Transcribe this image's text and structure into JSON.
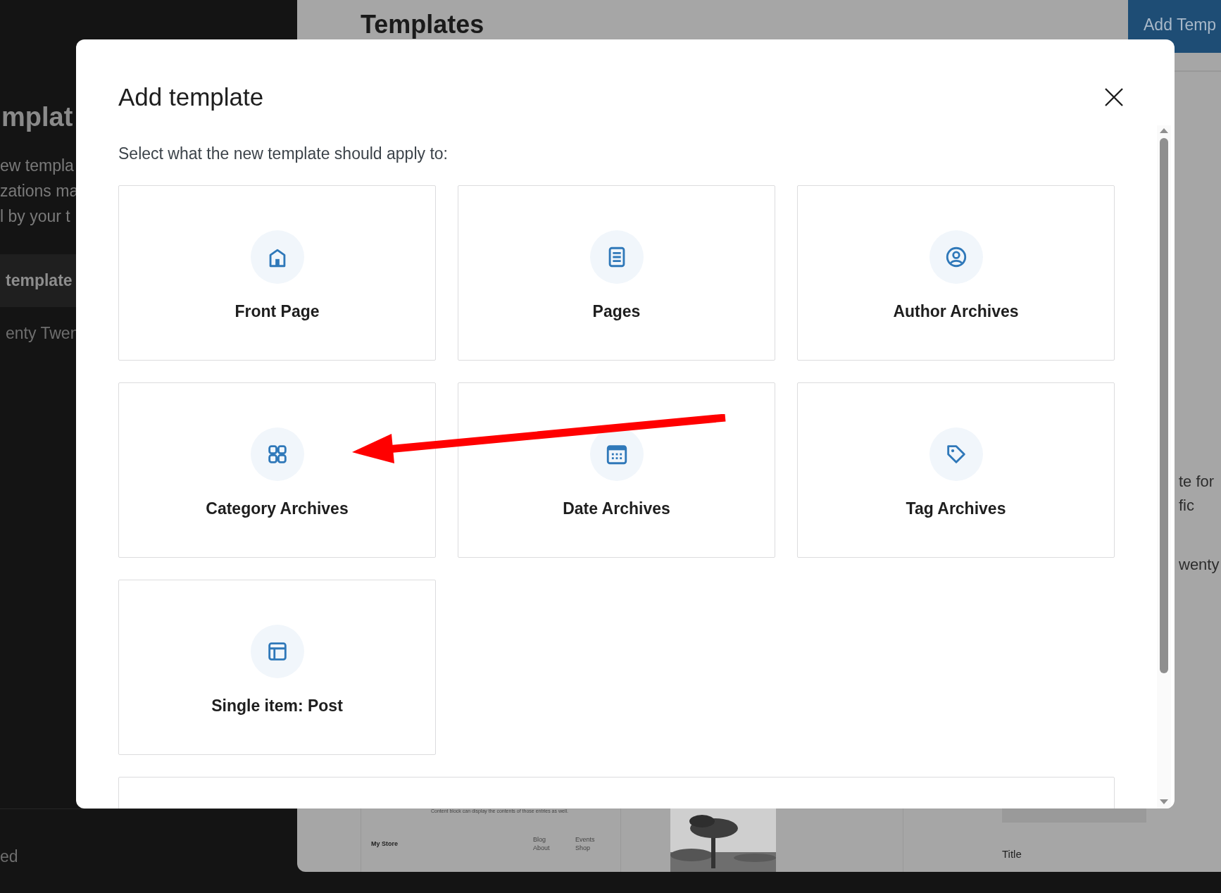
{
  "sidebar": {
    "title": "mplat",
    "description": [
      "ew templa",
      "zations ma",
      "l by your t"
    ],
    "items": [
      {
        "label": "template",
        "selected": true
      },
      {
        "label": "enty Twen",
        "selected": false
      }
    ],
    "footer": "ed"
  },
  "header": {
    "title": "Templates",
    "button": "Add Temp"
  },
  "background_texts": [
    "te for",
    "fic",
    "wenty"
  ],
  "preview": {
    "caption": "Content block can display the contents of those entries as well.",
    "site_title": "My Store",
    "links": [
      "Blog",
      "Events",
      "About",
      "Shop"
    ],
    "card_title": "Title"
  },
  "modal": {
    "title": "Add template",
    "subtitle": "Select what the new template should apply to:",
    "options": [
      {
        "label": "Front Page",
        "kind": "home"
      },
      {
        "label": "Pages",
        "kind": "pages"
      },
      {
        "label": "Author Archives",
        "kind": "author"
      },
      {
        "label": "Category Archives",
        "kind": "category"
      },
      {
        "label": "Date Archives",
        "kind": "date"
      },
      {
        "label": "Tag Archives",
        "kind": "tag"
      },
      {
        "label": "Single item: Post",
        "kind": "post"
      }
    ],
    "more_options_cut": true
  }
}
